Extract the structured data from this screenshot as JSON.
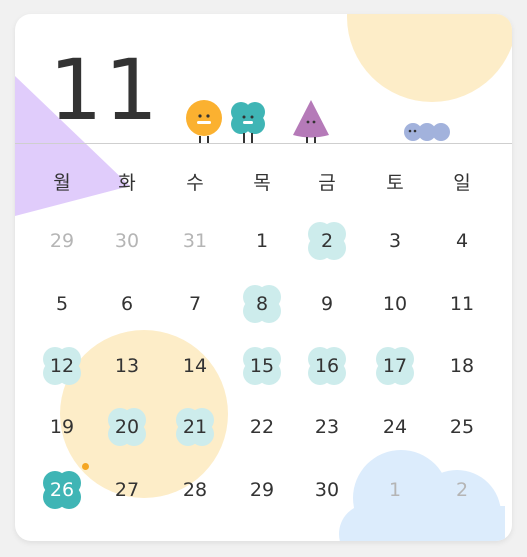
{
  "month": "11",
  "weekdays": [
    "월",
    "화",
    "수",
    "목",
    "금",
    "토",
    "일"
  ],
  "weeks": [
    [
      "29",
      "30",
      "31",
      "1",
      "2",
      "3",
      "4"
    ],
    [
      "5",
      "6",
      "7",
      "8",
      "9",
      "10",
      "11"
    ],
    [
      "12",
      "13",
      "14",
      "15",
      "16",
      "17",
      "18"
    ],
    [
      "19",
      "20",
      "21",
      "22",
      "23",
      "24",
      "25"
    ],
    [
      "26",
      "27",
      "28",
      "29",
      "30",
      "1",
      "2"
    ]
  ],
  "mascots": [
    "orange-circle-mascot",
    "teal-flower-mascot",
    "purple-triangle-mascot",
    "blue-caterpillar-mascot"
  ],
  "colors": {
    "text": "#333333",
    "muted": "#b5b5b5",
    "mint_badge": "#cdecec",
    "today_badge": "#3fb5b5",
    "event_dot": "#f4a623",
    "peach": "#fdedc8",
    "lavender": "#e0ccfb",
    "sky": "#dcecfc"
  }
}
